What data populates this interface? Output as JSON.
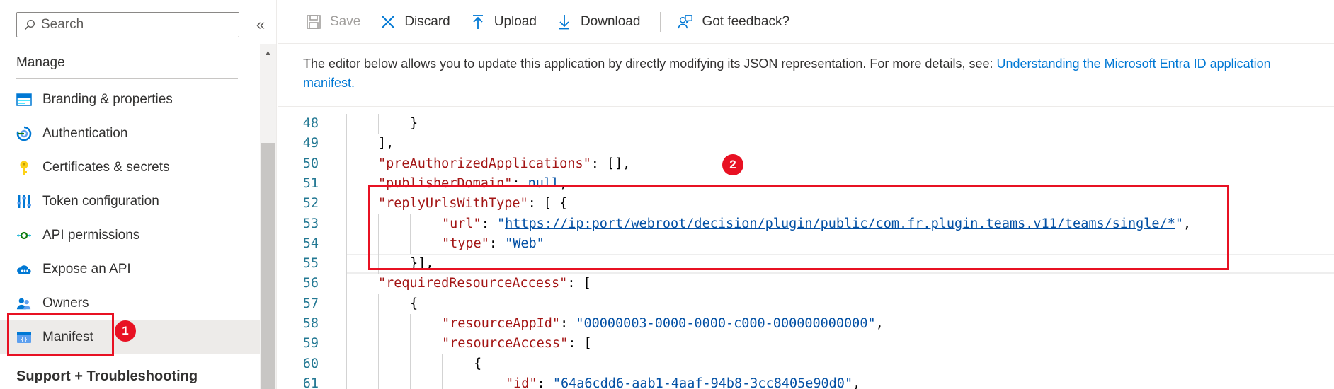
{
  "sidebar": {
    "search_placeholder": "Search",
    "collapse_glyph": "«",
    "section_manage": "Manage",
    "items": [
      {
        "label": "Branding & properties",
        "icon": "branding-icon"
      },
      {
        "label": "Authentication",
        "icon": "authentication-icon"
      },
      {
        "label": "Certificates & secrets",
        "icon": "key-icon"
      },
      {
        "label": "Token configuration",
        "icon": "token-config-icon"
      },
      {
        "label": "API permissions",
        "icon": "api-permissions-icon"
      },
      {
        "label": "Expose an API",
        "icon": "cloud-icon"
      },
      {
        "label": "Owners",
        "icon": "owners-icon"
      },
      {
        "label": "Manifest",
        "icon": "manifest-icon",
        "active": true
      }
    ],
    "section_support": "Support + Troubleshooting"
  },
  "toolbar": {
    "save": "Save",
    "discard": "Discard",
    "upload": "Upload",
    "download": "Download",
    "feedback": "Got feedback?"
  },
  "info": {
    "text": "The editor below allows you to update this application by directly modifying its JSON representation. For more details, see: ",
    "link_text": "Understanding the Microsoft Entra ID application manifest."
  },
  "annotations": {
    "badge_1": "1",
    "badge_2": "2"
  },
  "editor": {
    "lines": [
      {
        "num": "48",
        "indent": 2,
        "tokens": [
          {
            "t": "}",
            "c": "p"
          }
        ]
      },
      {
        "num": "49",
        "indent": 1,
        "tokens": [
          {
            "t": "],",
            "c": "p"
          }
        ]
      },
      {
        "num": "50",
        "indent": 1,
        "tokens": [
          {
            "t": "\"preAuthorizedApplications\"",
            "c": "k"
          },
          {
            "t": ": [],",
            "c": "p"
          }
        ]
      },
      {
        "num": "51",
        "indent": 1,
        "tokens": [
          {
            "t": "\"publisherDomain\"",
            "c": "k"
          },
          {
            "t": ": ",
            "c": "p"
          },
          {
            "t": "null",
            "c": "n"
          },
          {
            "t": ",",
            "c": "p"
          }
        ]
      },
      {
        "num": "52",
        "indent": 1,
        "tokens": [
          {
            "t": "\"replyUrlsWithType\"",
            "c": "k"
          },
          {
            "t": ": [ {",
            "c": "p"
          }
        ]
      },
      {
        "num": "53",
        "indent": 3,
        "tokens": [
          {
            "t": "\"url\"",
            "c": "k"
          },
          {
            "t": ": ",
            "c": "p"
          },
          {
            "t": "\"",
            "c": "s"
          },
          {
            "t": "https://ip:port/webroot/decision/plugin/public/com.fr.plugin.teams.v11/teams/single/*",
            "c": "s link"
          },
          {
            "t": "\"",
            "c": "s"
          },
          {
            "t": ",",
            "c": "p"
          }
        ]
      },
      {
        "num": "54",
        "indent": 3,
        "tokens": [
          {
            "t": "\"type\"",
            "c": "k"
          },
          {
            "t": ": ",
            "c": "p"
          },
          {
            "t": "\"Web\"",
            "c": "s"
          }
        ]
      },
      {
        "num": "55",
        "indent": 2,
        "current": true,
        "tokens": [
          {
            "t": "}],",
            "c": "p"
          }
        ]
      },
      {
        "num": "56",
        "indent": 1,
        "tokens": [
          {
            "t": "\"requiredResourceAccess\"",
            "c": "k"
          },
          {
            "t": ": [",
            "c": "p"
          }
        ]
      },
      {
        "num": "57",
        "indent": 2,
        "tokens": [
          {
            "t": "{",
            "c": "p"
          }
        ]
      },
      {
        "num": "58",
        "indent": 3,
        "tokens": [
          {
            "t": "\"resourceAppId\"",
            "c": "k"
          },
          {
            "t": ": ",
            "c": "p"
          },
          {
            "t": "\"00000003-0000-0000-c000-000000000000\"",
            "c": "s"
          },
          {
            "t": ",",
            "c": "p"
          }
        ]
      },
      {
        "num": "59",
        "indent": 3,
        "tokens": [
          {
            "t": "\"resourceAccess\"",
            "c": "k"
          },
          {
            "t": ": [",
            "c": "p"
          }
        ]
      },
      {
        "num": "60",
        "indent": 4,
        "tokens": [
          {
            "t": "{",
            "c": "p"
          }
        ]
      },
      {
        "num": "61",
        "indent": 5,
        "tokens": [
          {
            "t": "\"id\"",
            "c": "k"
          },
          {
            "t": ": ",
            "c": "p"
          },
          {
            "t": "\"64a6cdd6-aab1-4aaf-94b8-3cc8405e90d0\"",
            "c": "s"
          },
          {
            "t": ",",
            "c": "p"
          }
        ]
      }
    ]
  },
  "colors": {
    "accent": "#0078d4",
    "annotation": "#e81123",
    "json_key": "#a31515",
    "json_string": "#0451a5",
    "line_number": "#237893"
  }
}
